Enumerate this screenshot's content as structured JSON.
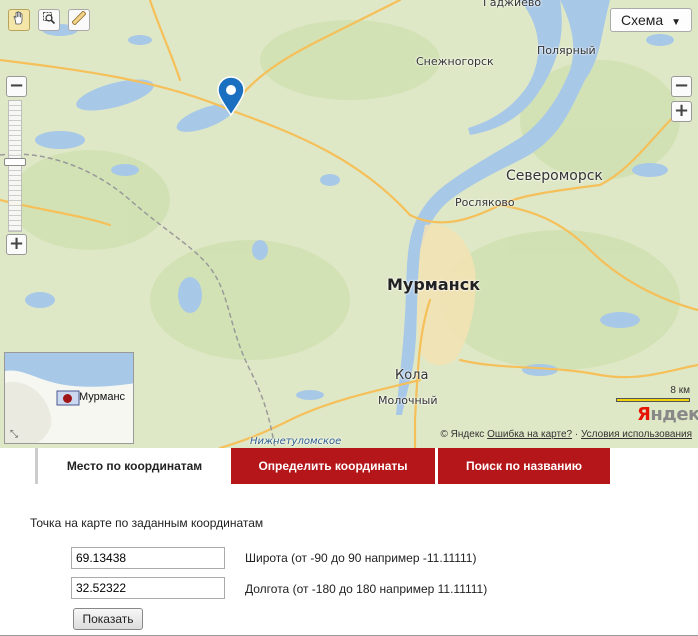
{
  "map": {
    "labels": {
      "gadzhievo": "Гаджиево",
      "snezhnogorsk": "Снежногорск",
      "polyarny": "Полярный",
      "severomorsk": "Североморск",
      "roslyakovo": "Росляково",
      "murmansk": "Мурманск",
      "kola": "Кола",
      "molochny": "Молочный",
      "nizhnetulomskoe": "Нижнетуломское"
    },
    "layer_button": "Схема",
    "scale_label": "8 км",
    "logo": "Яндекс",
    "copyright": {
      "owner": "© Яндекс",
      "error_link": "Ошибка на карте?",
      "terms_link": "Условия использования"
    },
    "minimap_label": "Мурманс",
    "tools": [
      "hand-icon",
      "magnifier-zoom-icon",
      "ruler-icon"
    ],
    "colors": {
      "water": "#a8c8e8",
      "land": "#dfe8c6",
      "road": "#f5c05a",
      "city": "#f3e2b3",
      "marker": "#1a6fc0"
    }
  },
  "tabs": [
    {
      "label": "Место по координатам",
      "active": true
    },
    {
      "label": "Определить координаты",
      "active": false
    },
    {
      "label": "Поиск по названию",
      "active": false
    }
  ],
  "form": {
    "heading": "Точка на карте по заданным координатам",
    "latitude_value": "69.13438",
    "latitude_label": "Широта (от -90 до 90 например -11.11111)",
    "longitude_value": "32.52322",
    "longitude_label": "Долгота (от -180 до 180 например 11.11111)",
    "submit_label": "Показать"
  }
}
